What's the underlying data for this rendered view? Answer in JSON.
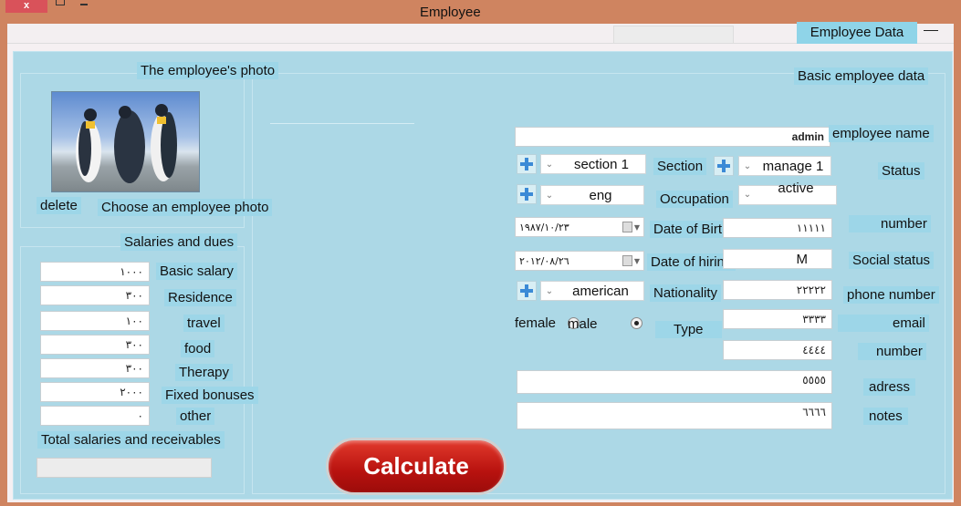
{
  "window": {
    "title": "Employee",
    "close_label": "x",
    "tab_label": "Employee Data"
  },
  "photo_section": {
    "title": "The employee's photo",
    "delete_label": "delete",
    "choose_label": "Choose an employee photo"
  },
  "salaries": {
    "title": "Salaries and dues",
    "rows": [
      {
        "label": "Basic salary",
        "value": "١٠٠٠"
      },
      {
        "label": "Residence",
        "value": "٣٠٠"
      },
      {
        "label": "travel",
        "value": "١٠٠"
      },
      {
        "label": "food",
        "value": "٣٠٠"
      },
      {
        "label": "Therapy",
        "value": "٣٠٠"
      },
      {
        "label": "Fixed bonuses",
        "value": "٢٠٠٠"
      },
      {
        "label": "other",
        "value": "٠"
      }
    ],
    "total_label": "Total salaries and receivables",
    "total_value": ""
  },
  "basic": {
    "title": "Basic employee data",
    "employee_name_label": "employee name",
    "employee_name_value": "admin",
    "section_label": "Section",
    "section_value": "section 1",
    "manage_value": "manage 1",
    "status_label": "Status",
    "status_value": "active",
    "occupation_label": "Occupation",
    "occupation_value": "eng",
    "dob_label": "Date of Birth",
    "dob_value": "١٩٨٧/١٠/٢٣",
    "hiring_label": "Date of hiring",
    "hiring_value": "٢٠١٢/٠٨/٢٦",
    "nationality_label": "Nationality",
    "nationality_value": "american",
    "gender_female": "female",
    "gender_male": "male",
    "gender_selected": "male",
    "type_label": "Type",
    "number_label": "number",
    "number_value": "١١١١١",
    "social_label": "Social status",
    "social_value": "M",
    "phone_label": "phone number",
    "phone_value": "٢٢٢٢٢",
    "email_label": "email",
    "email_value": "٣٣٣٣",
    "number2_label": "number",
    "number2_value": "٤٤٤٤",
    "address_label": "adress",
    "address_value": "٥٥٥٥",
    "notes_label": "notes",
    "notes_value": "٦٦٦٦"
  },
  "actions": {
    "calculate_label": "Calculate"
  }
}
